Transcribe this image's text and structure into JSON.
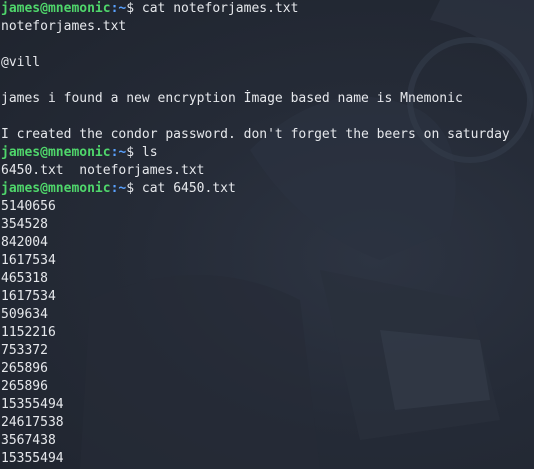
{
  "terminal": {
    "lines": [
      {
        "type": "prompt",
        "user": "james@mnemonic",
        "path": ":~",
        "symbol": "$ ",
        "command": "cat noteforjames.txt"
      },
      {
        "type": "output",
        "text": "noteforjames.txt"
      },
      {
        "type": "output",
        "text": ""
      },
      {
        "type": "output",
        "text": "@vill"
      },
      {
        "type": "output",
        "text": ""
      },
      {
        "type": "output",
        "text": "james i found a new encryption İmage based name is Mnemonic"
      },
      {
        "type": "output",
        "text": ""
      },
      {
        "type": "output",
        "text": "I created the condor password. don't forget the beers on saturday"
      },
      {
        "type": "prompt",
        "user": "james@mnemonic",
        "path": ":~",
        "symbol": "$ ",
        "command": "ls"
      },
      {
        "type": "output",
        "text": "6450.txt  noteforjames.txt"
      },
      {
        "type": "prompt",
        "user": "james@mnemonic",
        "path": ":~",
        "symbol": "$ ",
        "command": "cat 6450.txt"
      },
      {
        "type": "output",
        "text": "5140656"
      },
      {
        "type": "output",
        "text": "354528"
      },
      {
        "type": "output",
        "text": "842004"
      },
      {
        "type": "output",
        "text": "1617534"
      },
      {
        "type": "output",
        "text": "465318"
      },
      {
        "type": "output",
        "text": "1617534"
      },
      {
        "type": "output",
        "text": "509634"
      },
      {
        "type": "output",
        "text": "1152216"
      },
      {
        "type": "output",
        "text": "753372"
      },
      {
        "type": "output",
        "text": "265896"
      },
      {
        "type": "output",
        "text": "265896"
      },
      {
        "type": "output",
        "text": "15355494"
      },
      {
        "type": "output",
        "text": "24617538"
      },
      {
        "type": "output",
        "text": "3567438"
      },
      {
        "type": "output",
        "text": "15355494"
      }
    ]
  }
}
